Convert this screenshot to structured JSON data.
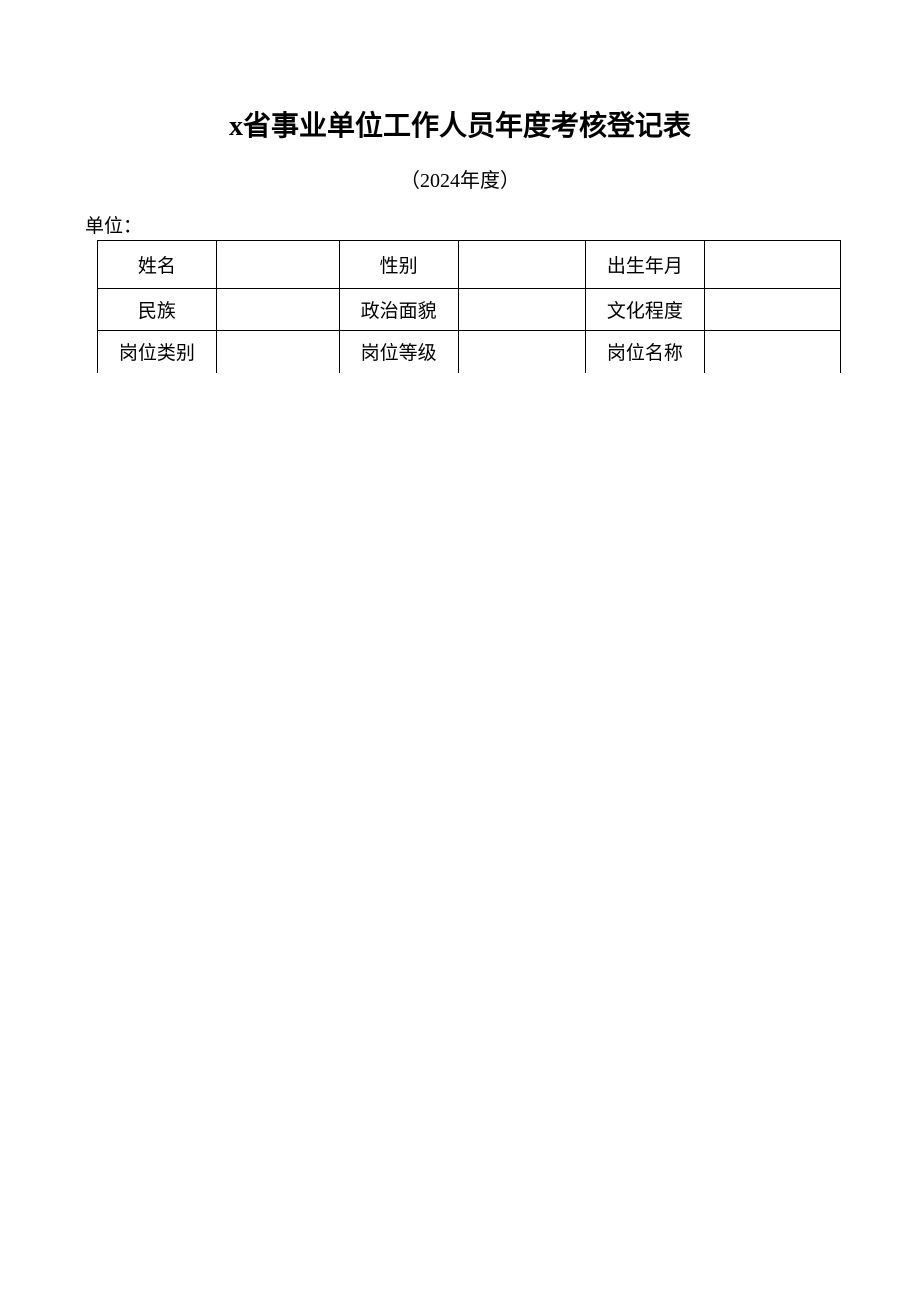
{
  "title": "x省事业单位工作人员年度考核登记表",
  "subtitle": "（2024年度）",
  "unit_label": "单位：",
  "unit_value": "",
  "fields": {
    "row1": {
      "name_label": "姓名",
      "name_value": "",
      "gender_label": "性别",
      "gender_value": "",
      "birth_label": "出生年月",
      "birth_value": ""
    },
    "row2": {
      "ethnicity_label": "民族",
      "ethnicity_value": "",
      "political_label": "政治面貌",
      "political_value": "",
      "education_label": "文化程度",
      "education_value": ""
    },
    "row3": {
      "post_category_label": "岗位类别",
      "post_category_value": "",
      "post_level_label": "岗位等级",
      "post_level_value": "",
      "post_name_label": "岗位名称",
      "post_name_value": ""
    }
  }
}
